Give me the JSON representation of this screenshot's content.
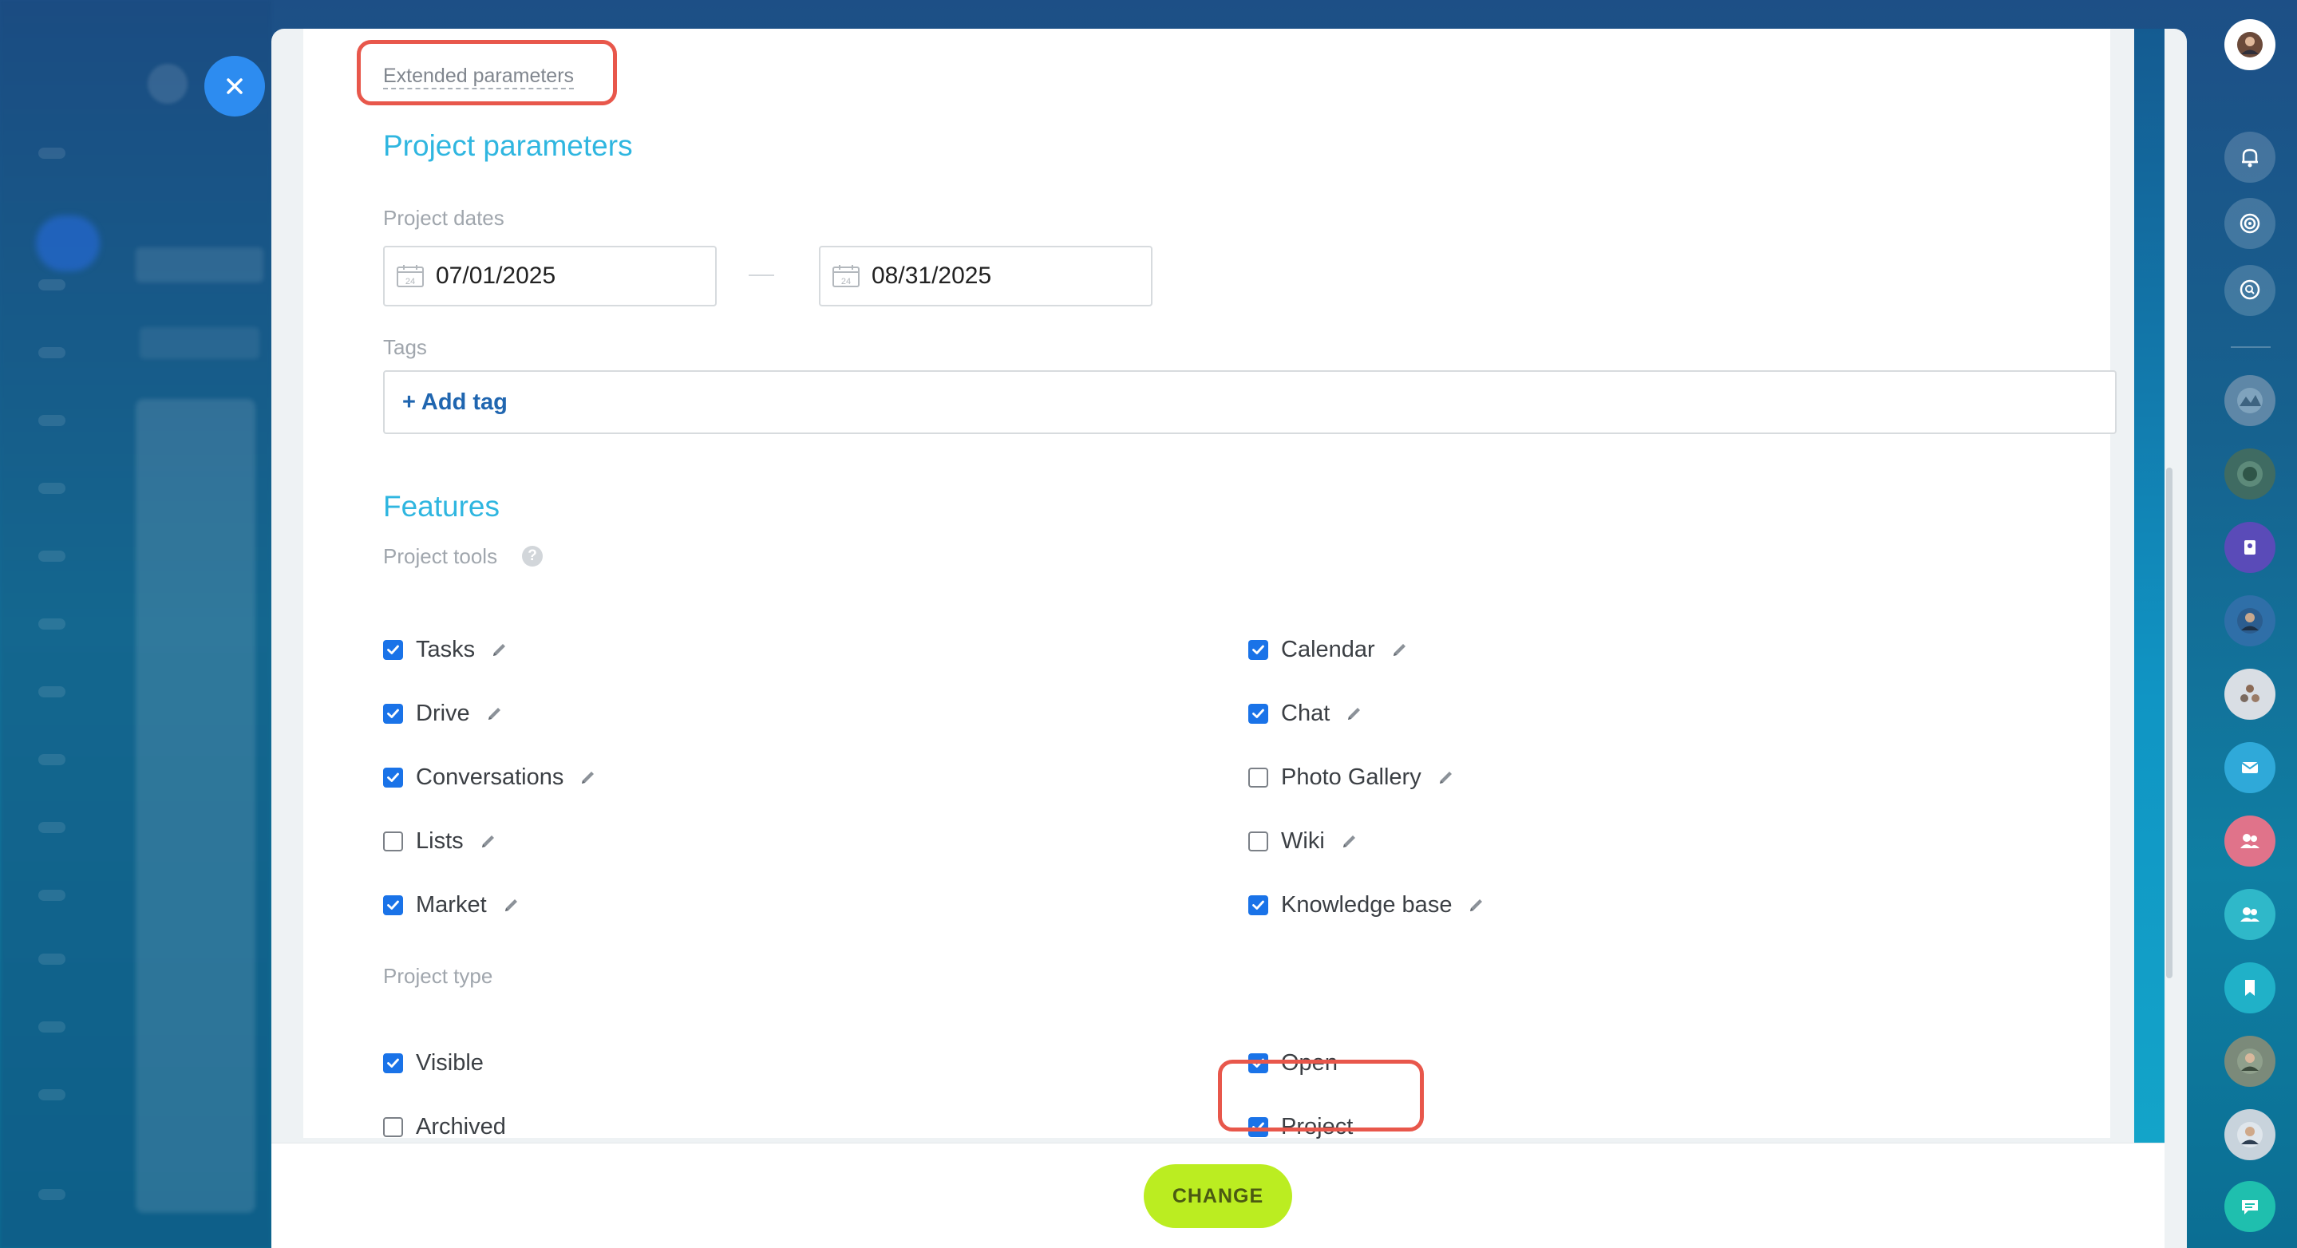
{
  "extended_parameters_link": "Extended parameters",
  "project_parameters": {
    "title": "Project parameters",
    "dates_label": "Project dates",
    "start_date": "07/01/2025",
    "end_date": "08/31/2025",
    "calendar_day": "24",
    "tags_label": "Tags",
    "add_tag": "+ Add tag"
  },
  "features": {
    "title": "Features",
    "tools_label": "Project tools",
    "help_glyph": "?",
    "tools": [
      {
        "label": "Tasks",
        "checked": true
      },
      {
        "label": "Drive",
        "checked": true
      },
      {
        "label": "Conversations",
        "checked": true
      },
      {
        "label": "Lists",
        "checked": false
      },
      {
        "label": "Market",
        "checked": true
      },
      {
        "label": "Calendar",
        "checked": true
      },
      {
        "label": "Chat",
        "checked": true
      },
      {
        "label": "Photo Gallery",
        "checked": false
      },
      {
        "label": "Wiki",
        "checked": false
      },
      {
        "label": "Knowledge base",
        "checked": true
      }
    ],
    "type_label": "Project type",
    "types": [
      {
        "label": "Visible",
        "checked": true
      },
      {
        "label": "Archived",
        "checked": false
      },
      {
        "label": "Open",
        "checked": true
      },
      {
        "label": "Project",
        "checked": true
      }
    ]
  },
  "footer": {
    "change_label": "CHANGE"
  },
  "colors": {
    "accent": "#2fb6e0",
    "checkbox": "#1a73e8",
    "change_button": "#bbed21",
    "highlight": "#e8574b"
  },
  "right_panel_icons": [
    "user-avatar-icon",
    "bell-icon",
    "target-icon",
    "search-chat-icon",
    "group-avatar-icon",
    "group-avatar-icon",
    "contact-book-icon",
    "user-avatar-icon",
    "multi-user-avatar-icon",
    "mail-icon",
    "group-icon",
    "group-icon",
    "bookmark-icon",
    "user-avatar-icon",
    "user-avatar-icon",
    "chat-bubble-icon"
  ]
}
